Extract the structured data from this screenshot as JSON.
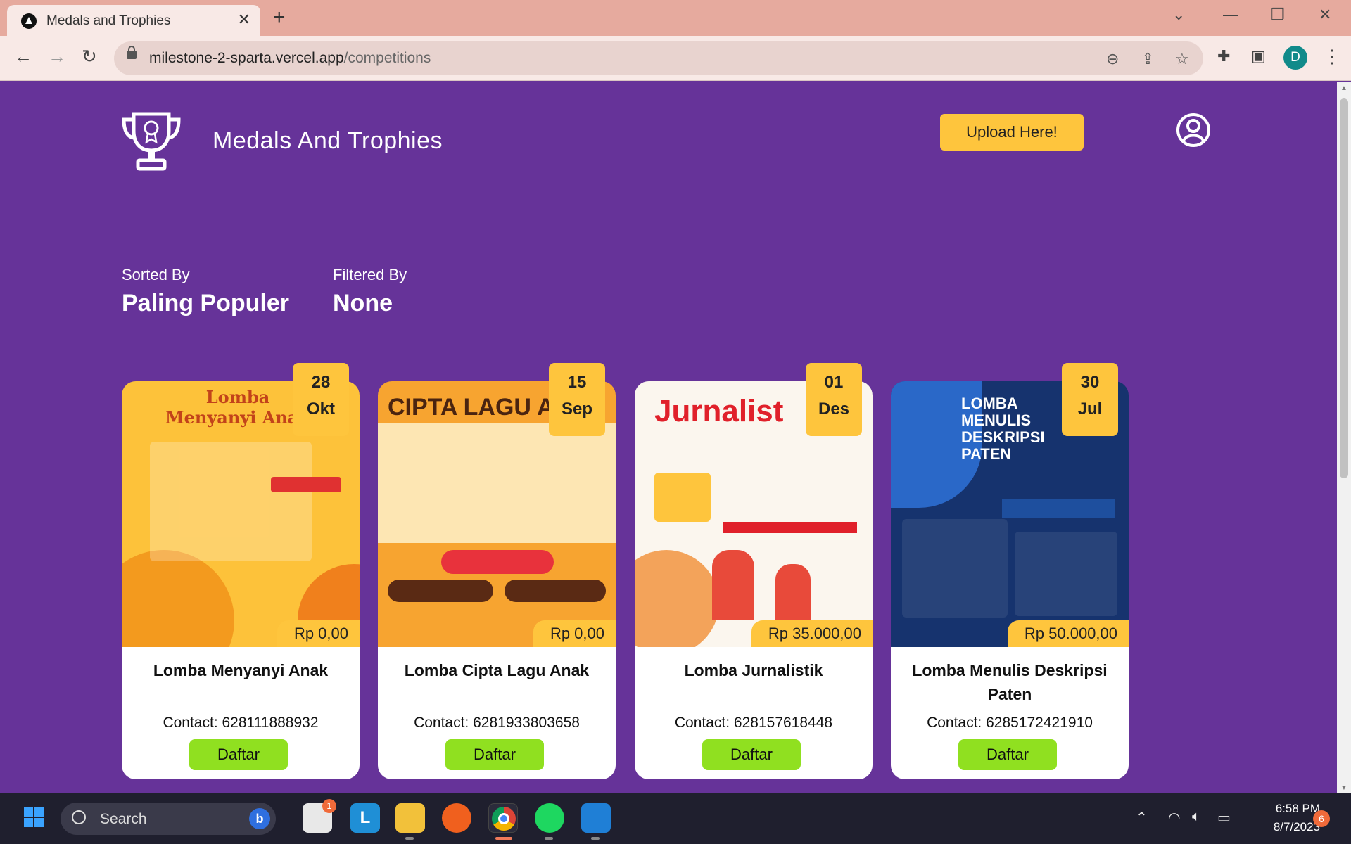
{
  "browser": {
    "tab_title": "Medals and Trophies",
    "tab_close": "✕",
    "new_tab": "+",
    "url_host": "milestone-2-sparta.vercel.app",
    "url_path": "/competitions",
    "profile_initial": "D"
  },
  "header": {
    "brand": "Medals And Trophies",
    "upload_label": "Upload Here!"
  },
  "sort": {
    "sorted_label": "Sorted By",
    "sorted_value": "Paling Populer",
    "filtered_label": "Filtered By",
    "filtered_value": "None"
  },
  "cards": [
    {
      "title": "Lomba Menyanyi Anak",
      "day": "28",
      "month": "Okt",
      "price": "Rp 0,00",
      "contact": "Contact: 628111888932",
      "cta": "Daftar",
      "poster_title": "Lomba Menyanyi Anak",
      "poster_bg": "#fdc23a"
    },
    {
      "title": "Lomba Cipta Lagu Anak",
      "day": "15",
      "month": "Sep",
      "price": "Rp 0,00",
      "contact": "Contact: 6281933803658",
      "cta": "Daftar",
      "poster_title": "CIPTA LAGU A",
      "poster_bg": "#f7a430"
    },
    {
      "title": "Lomba Jurnalistik",
      "day": "01",
      "month": "Des",
      "price": "Rp 35.000,00",
      "contact": "Contact: 628157618448",
      "cta": "Daftar",
      "poster_title": "Jurnalist",
      "poster_bg": "#fbf6ee"
    },
    {
      "title": "Lomba Menulis Deskripsi Paten",
      "day": "30",
      "month": "Jul",
      "price": "Rp 50.000,00",
      "contact": "Contact: 6285172421910",
      "cta": "Daftar",
      "poster_title": "LOMBA MENULIS DESKRIPSI PATEN",
      "poster_bg": "#16336e"
    }
  ],
  "taskbar": {
    "search_label": "Search",
    "store_badge": "1",
    "time": "6:58 PM",
    "date": "8/7/2023",
    "notifications": "6"
  },
  "colors": {
    "page_bg": "#663399",
    "accent_yellow": "#fec53d",
    "cta_green": "#90e020"
  }
}
